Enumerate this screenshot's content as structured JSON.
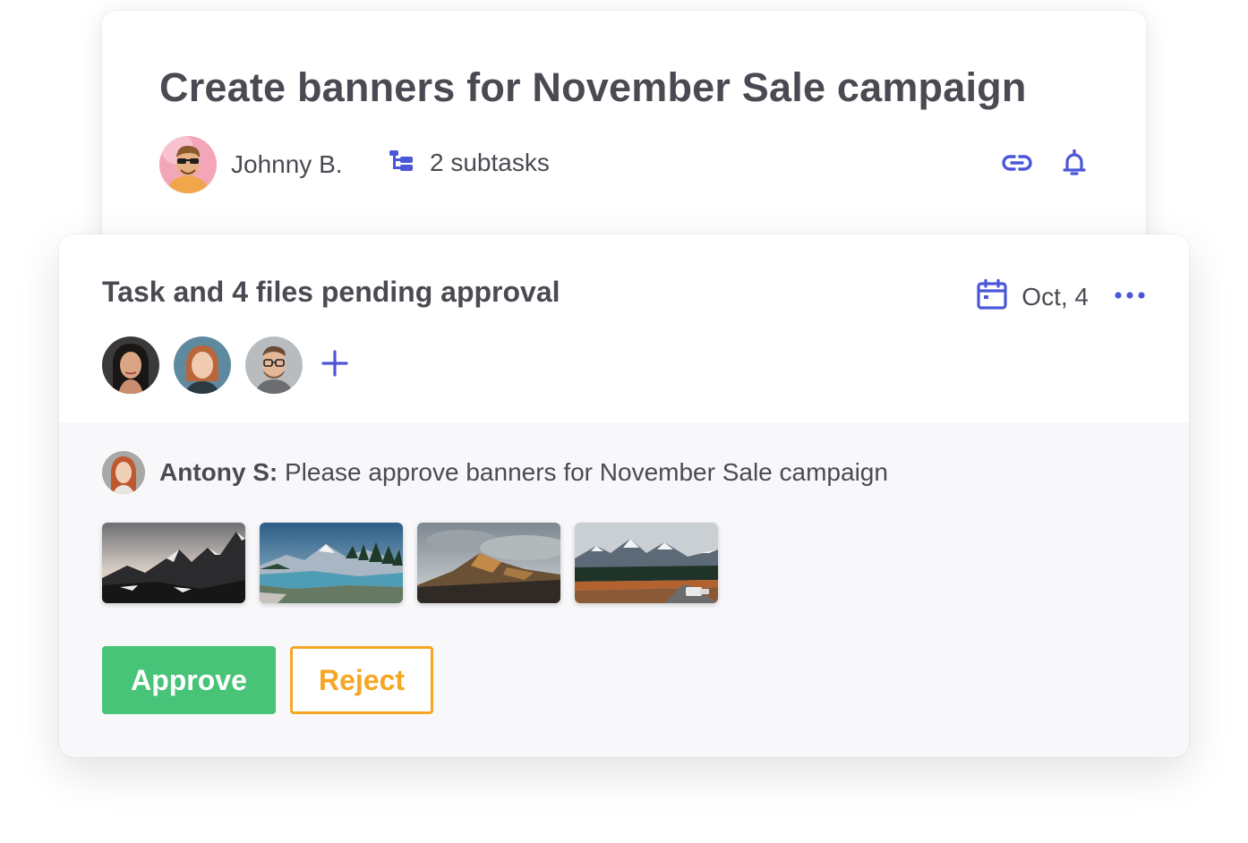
{
  "task": {
    "title": "Create banners for November Sale campaign",
    "owner": {
      "name": "Johnny B.",
      "avatar": "owner-avatar"
    },
    "subtasks_label": "2 subtasks",
    "icons": [
      "subtasks-icon",
      "link-icon",
      "bell-icon"
    ]
  },
  "approval": {
    "title": "Task and 4 files pending approval",
    "due_date": "Oct, 4",
    "icons": [
      "calendar-icon",
      "more-icon",
      "plus-icon"
    ],
    "reviewers": [
      {
        "avatar": "reviewer-avatar-1"
      },
      {
        "avatar": "reviewer-avatar-2"
      },
      {
        "avatar": "reviewer-avatar-3"
      }
    ],
    "comment": {
      "author": "Antony S:",
      "text": " Please approve banners for November Sale campaign"
    },
    "attachments": [
      {
        "kind": "mountain-peaks-photo"
      },
      {
        "kind": "mountain-lake-photo"
      },
      {
        "kind": "hills-cloudy-photo"
      },
      {
        "kind": "mountain-road-photo"
      }
    ],
    "approve_label": "Approve",
    "reject_label": "Reject"
  },
  "colors": {
    "accent": "#4c56d8",
    "approve": "#47c477",
    "reject": "#f5a623",
    "text": "#4a4b52",
    "panel_bg": "#f8f8fa"
  }
}
